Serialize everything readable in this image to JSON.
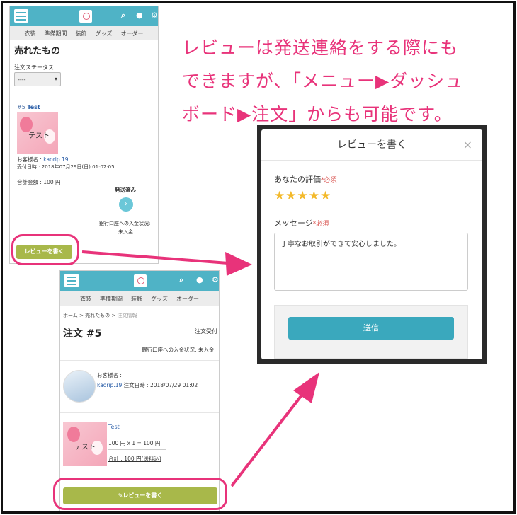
{
  "caption": {
    "line1": "レビューは発送連絡をする際にも",
    "line2": "できますが、「メニュー▶ダッシュ",
    "line3": "ボード▶注文」からも可能です。"
  },
  "screen1": {
    "nav": [
      "衣装",
      "準備期間",
      "装飾",
      "グッズ",
      "オーダー"
    ],
    "title": "売れたもの",
    "status_label": "注文ステータス",
    "select_value": "----",
    "order_num": "#5",
    "order_name": "Test",
    "thumb_text": "テスト",
    "customer_label": "お客様名 : ",
    "customer_name": "kaorip.19",
    "received": "受付日時 : 2018年07月29日(日) 01:02:05",
    "total": "合計金額 : 100 円",
    "shipped": "発送済み",
    "bank_label": "銀行口座への入金状況:",
    "bank_value": "未入金",
    "review_btn": "レビューを書く"
  },
  "screen2": {
    "nav": [
      "衣装",
      "準備期間",
      "装飾",
      "グッズ",
      "オーダー"
    ],
    "breadcrumb": [
      "ホーム",
      ">",
      "売れたもの",
      ">",
      "注文情報"
    ],
    "title": "注文 #5",
    "status": "注文受付",
    "bank": "銀行口座への入金状況: 未入金",
    "customer_label": "お客様名 :",
    "customer_name": "kaorip.19",
    "order_date": "注文日時 : 2018/07/29 01:02",
    "item_name": "Test",
    "thumb_text": "テスト",
    "price_line": "100 円 x 1 = 100 円",
    "total_line": "合計 : 100 円(送料込)",
    "review_btn": "✎レビューを書く"
  },
  "modal": {
    "title": "レビューを書く",
    "close": "×",
    "rating_label": "あなたの評価",
    "required": "*必須",
    "stars": "★★★★★",
    "rating": 5,
    "message_label": "メッセージ",
    "message_value": "丁寧なお取引ができて安心しました。",
    "submit": "送信"
  },
  "colors": {
    "accent_pink": "#e8337a",
    "topbar": "#4fb3c6",
    "review_green": "#a8b84a",
    "send_teal": "#3aa8bd"
  }
}
